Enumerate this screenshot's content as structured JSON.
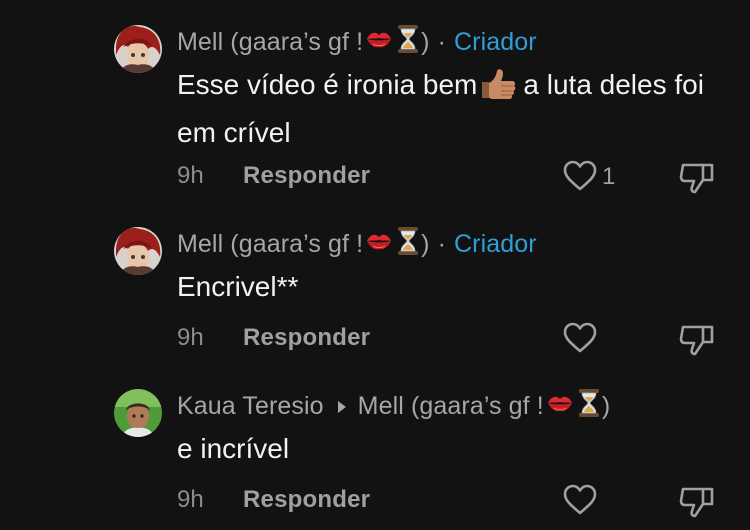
{
  "comments": [
    {
      "author": "Mell (gaara’s gf !",
      "author_suffix": ")",
      "emoji_1": "kiss-mark-icon",
      "emoji_2": "hourglass-icon",
      "separator": "·",
      "badge": "Criador",
      "text_part1": "Esse vídeo é ironia bem",
      "inline_emoji": "thumbs-up-icon",
      "text_part2": "a luta deles foi em crível",
      "time": "9h",
      "reply_label": "Responder",
      "likes": "1"
    },
    {
      "author": "Mell (gaara’s gf !",
      "author_suffix": ")",
      "emoji_1": "kiss-mark-icon",
      "emoji_2": "hourglass-icon",
      "separator": "·",
      "badge": "Criador",
      "text": "Encrivel**",
      "time": "9h",
      "reply_label": "Responder"
    },
    {
      "author": "Kaua Teresio",
      "reply_to": "Mell (gaara’s gf !",
      "reply_to_suffix": ")",
      "emoji_1": "kiss-mark-icon",
      "emoji_2": "hourglass-icon",
      "text": "e incrível",
      "time": "9h",
      "reply_label": "Responder"
    }
  ],
  "colors": {
    "background": "#121212",
    "text": "#f2f2f2",
    "muted": "#a6a6a6",
    "creator_badge": "#2f9fd6"
  }
}
